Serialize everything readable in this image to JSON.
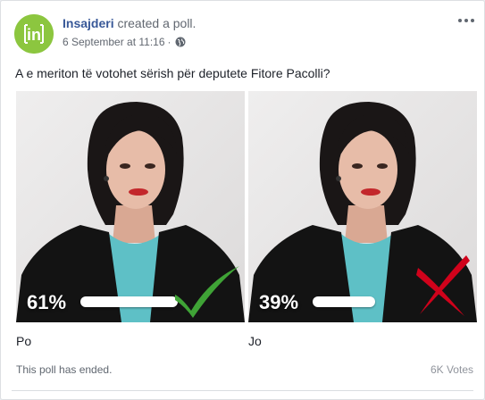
{
  "post": {
    "author": "Insajderi",
    "action": "created a poll.",
    "timestamp": "6 September at 11:16",
    "separator": "·",
    "privacy_icon": "globe-icon",
    "menu_icon": "more-options-icon",
    "avatar_text": "in"
  },
  "poll": {
    "question": "A e meriton të votohet sërish për deputete Fitore Pacolli?",
    "options": [
      {
        "label": "Po",
        "percent_label": "61%",
        "percent": 61,
        "result_icon": "checkmark-icon",
        "result_color": "#3fa336"
      },
      {
        "label": "Jo",
        "percent_label": "39%",
        "percent": 39,
        "result_icon": "cross-icon",
        "result_color": "#d0021b"
      }
    ],
    "status": "This poll has ended.",
    "votes": "6K Votes"
  },
  "colors": {
    "author_link": "#385898",
    "avatar_bg": "#8cc63f"
  }
}
